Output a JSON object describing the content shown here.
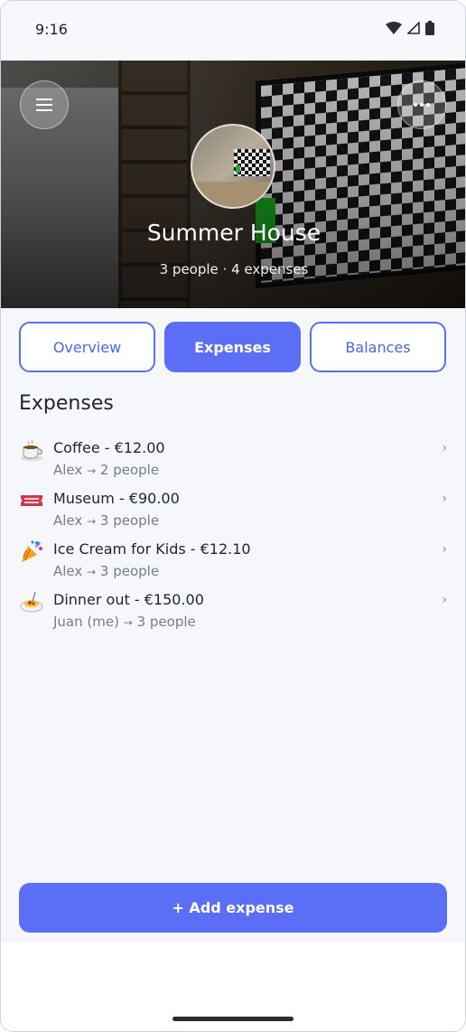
{
  "status_bar": {
    "time": "9:16"
  },
  "header": {
    "group_name": "Summer House",
    "summary": "3 people · 4 expenses",
    "menu_icon": "hamburger-menu-icon",
    "more_icon": "more-dots-icon"
  },
  "tabs": [
    {
      "label": "Overview",
      "active": false
    },
    {
      "label": "Expenses",
      "active": true
    },
    {
      "label": "Balances",
      "active": false
    }
  ],
  "section_title": "Expenses",
  "expenses": [
    {
      "icon": "coffee-icon",
      "title": "Coffee - €12.00",
      "payer": "Alex",
      "arrow": "→",
      "participants": "2 people"
    },
    {
      "icon": "ticket-icon",
      "title": "Museum - €90.00",
      "payer": "Alex",
      "arrow": "→",
      "participants": "3 people"
    },
    {
      "icon": "party-popper-icon",
      "title": "Ice Cream for Kids - €12.10",
      "payer": "Alex",
      "arrow": "→",
      "participants": "3 people"
    },
    {
      "icon": "spaghetti-icon",
      "title": "Dinner out - €150.00",
      "payer": "Juan (me)",
      "arrow": "→",
      "participants": "3 people"
    }
  ],
  "chevron": "›",
  "add_button_label": "+ Add expense",
  "colors": {
    "accent": "#5a6ff6",
    "background": "#f6f7fb"
  }
}
